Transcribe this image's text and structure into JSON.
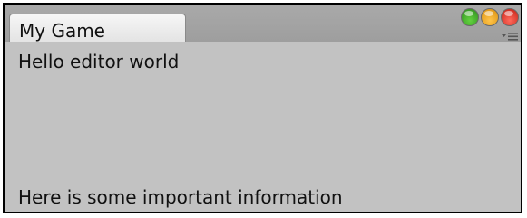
{
  "window": {
    "tab_title": "My Game"
  },
  "content": {
    "label_top": "Hello editor world",
    "label_bottom": "Here is some important information"
  },
  "window_controls": [
    "green-button",
    "yellow-button",
    "red-button"
  ],
  "icons": {
    "menu": "tab-menu-icon"
  }
}
